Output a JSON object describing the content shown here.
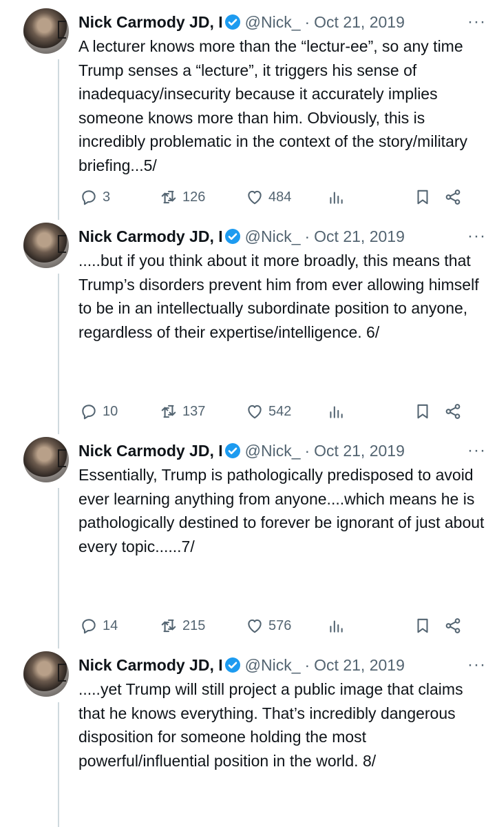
{
  "colors": {
    "text": "#0f1419",
    "secondary": "#536471",
    "verified": "#1d9bf0",
    "rail": "#cfd9de"
  },
  "tweets": [
    {
      "author": "Nick Carmody JD, I",
      "handle": "@Nick_",
      "separator": "·",
      "date": "Oct 21, 2019",
      "more": "···",
      "text": "A lecturer knows more than the “lectur-ee”, so any time Trump senses a “lecture”, it triggers his sense of inadequacy/insecurity because it accurately implies someone knows more than him.  Obviously, this is incredibly problematic in the context of the story/military briefing...5/",
      "replies": "3",
      "retweets": "126",
      "likes": "484"
    },
    {
      "author": "Nick Carmody JD, I",
      "handle": "@Nick_",
      "separator": "·",
      "date": "Oct 21, 2019",
      "more": "···",
      "text": ".....but if you think about it more broadly, this means that Trump’s disorders prevent him from ever allowing himself to be in an intellectually subordinate position to anyone, regardless of their expertise/intelligence.  6/",
      "replies": "10",
      "retweets": "137",
      "likes": "542"
    },
    {
      "author": "Nick Carmody JD, I",
      "handle": "@Nick_",
      "separator": "·",
      "date": "Oct 21, 2019",
      "more": "···",
      "text": "Essentially, Trump is pathologically predisposed to avoid ever learning anything from anyone....which means he is pathologically destined to forever be ignorant of just about every topic......7/",
      "replies": "14",
      "retweets": "215",
      "likes": "576"
    },
    {
      "author": "Nick Carmody JD, I",
      "handle": "@Nick_",
      "separator": "·",
      "date": "Oct 21, 2019",
      "more": "···",
      "text": ".....yet Trump will still project a public image that claims that he knows everything.  That’s incredibly dangerous disposition for someone holding the most powerful/influential position in the world. 8/"
    }
  ]
}
